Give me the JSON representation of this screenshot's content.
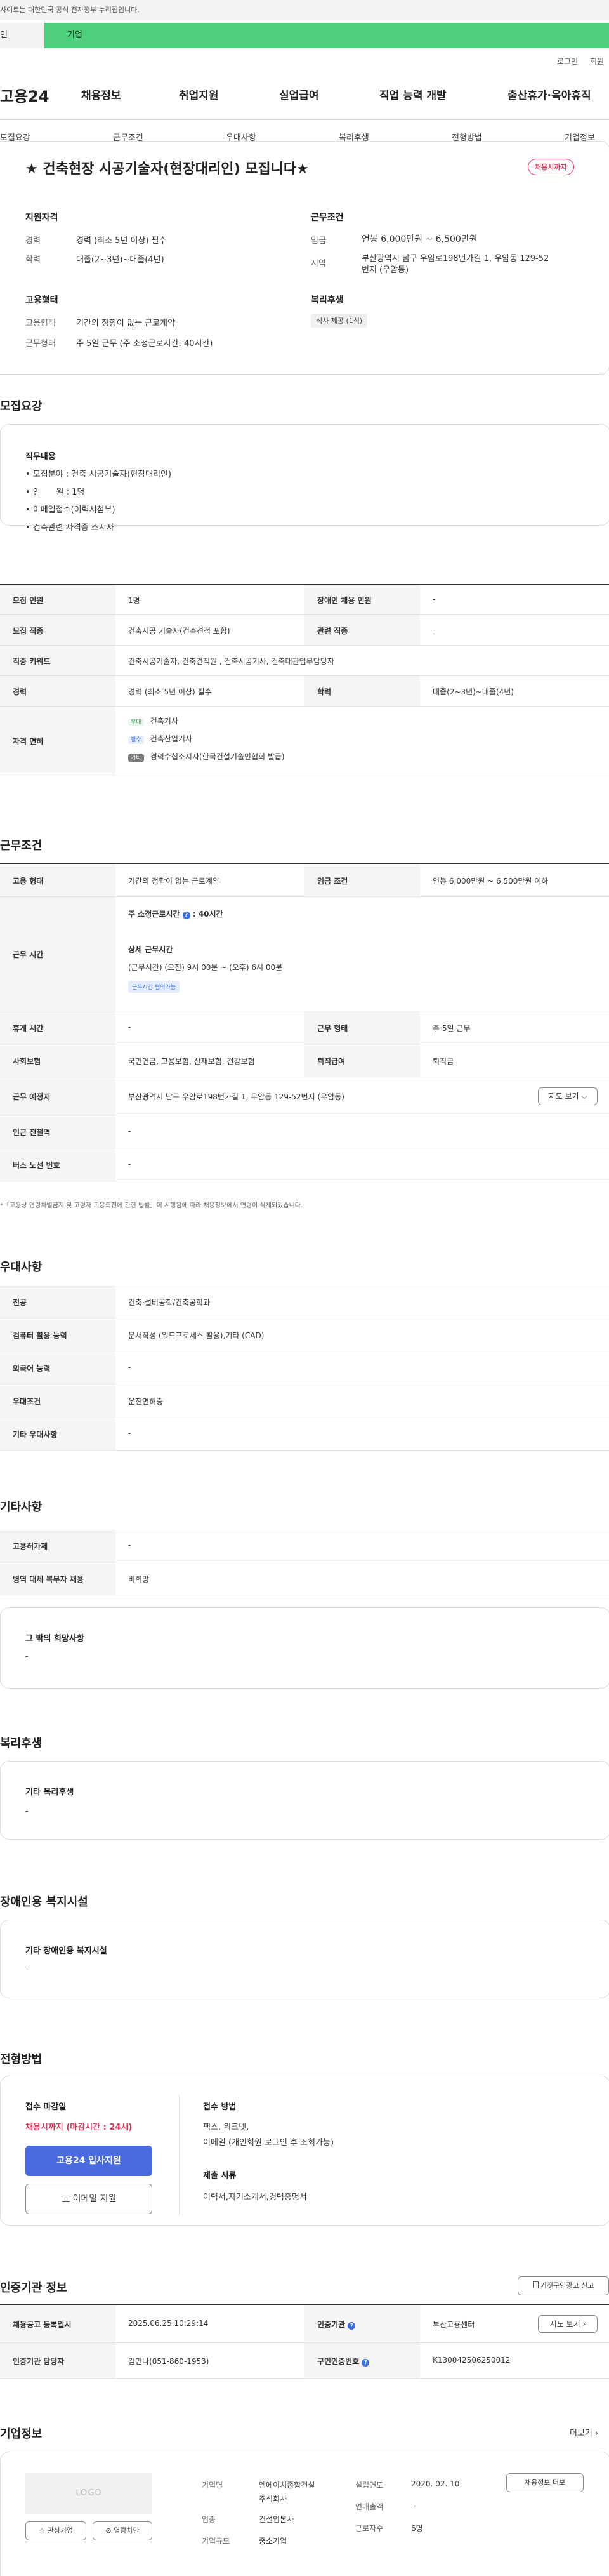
{
  "top": {
    "notice": "사이트는 대한민국 공식 전자정부 누리집입니다.",
    "tab_left": "인",
    "tab_right": "기업"
  },
  "util": {
    "login": "로그인",
    "join": "회원"
  },
  "header": {
    "logo": "고용24",
    "gnb": [
      "채용정보",
      "취업지원",
      "실업급여",
      "직업 능력 개발",
      "출산휴가·육아휴직"
    ]
  },
  "subnav": [
    "모집요강",
    "근무조건",
    "우대사항",
    "복리후생",
    "전형방법",
    "기업정보"
  ],
  "summary": {
    "title": "★ 건축현장 시공기술자(현장대리인) 모집니다★",
    "status": "채용시까지",
    "qual_title": "지원자격",
    "career_lbl": "경력",
    "career_val": "경력 (최소 5년 이상) 필수",
    "edu_lbl": "학력",
    "edu_val": "대졸(2~3년)~대졸(4년)",
    "work_title": "근무조건",
    "pay_lbl": "임금",
    "pay_val": "연봉 6,000만원 ~ 6,500만원",
    "loc_lbl": "지역",
    "loc_val1": "부산광역시 남구 우암로198번가길 1, 우암동 129-52",
    "loc_val2": "번지 (우암동)",
    "emp_title": "고용형태",
    "emptype_lbl": "고용형태",
    "emptype_val": "기간의 정함이 없는 근로계약",
    "hours_lbl": "근무형태",
    "hours_val": "주 5일 근무 (주 소정근로시간: 40시간)",
    "welfare_title": "복리후생",
    "welfare_chip": "식사 제공 (1식)"
  },
  "recruit": {
    "title": "모집요강",
    "duty_title": "직무내용",
    "duty_lines": [
      "• 모집분야 : 건축 시공기술자(현장대리인)",
      "• 인      원 : 1명",
      "• 이메일접수(이력서첨부)",
      "• 건축관련 자격증 소지자"
    ],
    "r1": [
      "모집 인원",
      "1명",
      "장애인 채용 인원",
      "-"
    ],
    "r2": [
      "모집 직종",
      "건축시공 기술자(건축견적 포함)",
      "관련 직종",
      "-"
    ],
    "r3": [
      "직종 키워드",
      "건축시공기술자, 건축견적원 , 건축시공기사, 건축대관업무담당자"
    ],
    "r4": [
      "경력",
      "경력 (최소 5년 이상) 필수",
      "학력",
      "대졸(2~3년)~대졸(4년)"
    ],
    "license_lbl": "자격 면허",
    "lic": [
      {
        "chip": "우대",
        "name": "건축기사"
      },
      {
        "chip": "필수",
        "name": "건축산업기사"
      },
      {
        "chip": "기타",
        "name": "경력수첩소지자(한국건설기술인협회 발급)"
      }
    ]
  },
  "work": {
    "title": "근무조건",
    "r1": [
      "고용 형태",
      "기간의 정함이 없는 근로계약",
      "임금 조건",
      "연봉 6,000만원 ~ 6,500만원 이하"
    ],
    "hours_lbl": "근무 시간",
    "hours_main": "주 소정근로시간",
    "hours_q": "?",
    "hours_main2": ": 40시간",
    "detail_title": "상세 근무시간",
    "detail_val": "(근무시간) (오전) 9시 00분 ~ (오후) 6시 00분",
    "detail_chip": "근무시간 협의가능",
    "r3": [
      "휴게 시간",
      "-",
      "근무 형태",
      "주 5일 근무"
    ],
    "r4": [
      "사회보험",
      "국민연금, 고용보험, 산재보험, 건강보험",
      "퇴직급여",
      "퇴직금"
    ],
    "r5": [
      "근무 예정지",
      "부산광역시 남구 우암로198번가길 1, 우암동 129-52번지 (우암동)"
    ],
    "map_btn": "지도 보기 ⌵",
    "r6": [
      "인근 전철역",
      "-"
    ],
    "r7": [
      "버스 노선 번호",
      "-"
    ],
    "footnote": "*「고용상 연령차별금지 및 고령자 고용촉진에 관한 법률」이 시행됨에 따라 채용정보에서 연령이 삭제되었습니다."
  },
  "pref": {
    "title": "우대사항",
    "rows": [
      [
        "전공",
        "건축·설비공학/건축공학과"
      ],
      [
        "컴퓨터 활용 능력",
        "문서작성 (워드프로세스 활용),기타 (CAD)"
      ],
      [
        "외국어 능력",
        "-"
      ],
      [
        "우대조건",
        "운전면허증"
      ],
      [
        "기타 우대사항",
        "-"
      ]
    ]
  },
  "etc": {
    "title": "기타사항",
    "rows": [
      [
        "고용허가제",
        "-"
      ],
      [
        "병역 대체 복무자 채용",
        "비희망"
      ]
    ],
    "box_title": "그 밖의 희망사항",
    "box_val": "-"
  },
  "welfare": {
    "title": "복리후생",
    "box_title": "기타 복리후생",
    "box_val": "-"
  },
  "disabled": {
    "title": "장애인용 복지시설",
    "box_title": "기타 장애인용 복지시설",
    "box_val": "-"
  },
  "process": {
    "title": "전형방법",
    "deadline_lbl": "접수 마감일",
    "deadline_val": "채용시까지 (마감시간 : 24시)",
    "apply_btn": "고용24 입사지원",
    "email_btn": "이메일 지원",
    "method_lbl": "접수 방법",
    "method_val1": "팩스, 워크넷,",
    "method_val2": "이메일 (개인회원 로그인 후 조회가능)",
    "docs_lbl": "제출 서류",
    "docs_val": "이력서,자기소개서,경력증명서"
  },
  "cert": {
    "title": "인증기관 정보",
    "report_btn": "거짓구인광고 신고",
    "r1": [
      "채용공고 등록일시",
      "2025.06.25 10:29:14",
      "인증기관",
      "부산고용센터"
    ],
    "q": "?",
    "map_btn": "지도 보기 ›",
    "r2": [
      "인증기관 담당자",
      "김민나(051-860-1953)",
      "구인인증번호",
      "K130042506250012"
    ]
  },
  "company": {
    "title": "기업정보",
    "more": "더보기 ›",
    "logo": "LOGO",
    "fav_btn": "관심기업",
    "block_btn": "열람차단",
    "name_lbl": "기업명",
    "name_val1": "엠에이치종합건설",
    "name_val2": "주식회사",
    "ind_lbl": "업종",
    "ind_val": "건설업본사",
    "size_lbl": "기업규모",
    "size_val": "중소기업",
    "est_lbl": "설립연도",
    "est_val": "2020. 02. 10",
    "sales_lbl": "연매출액",
    "sales_val": "-",
    "emp_lbl": "근로자수",
    "emp_val": "6명",
    "jobs_btn": "채용정보 더보"
  }
}
